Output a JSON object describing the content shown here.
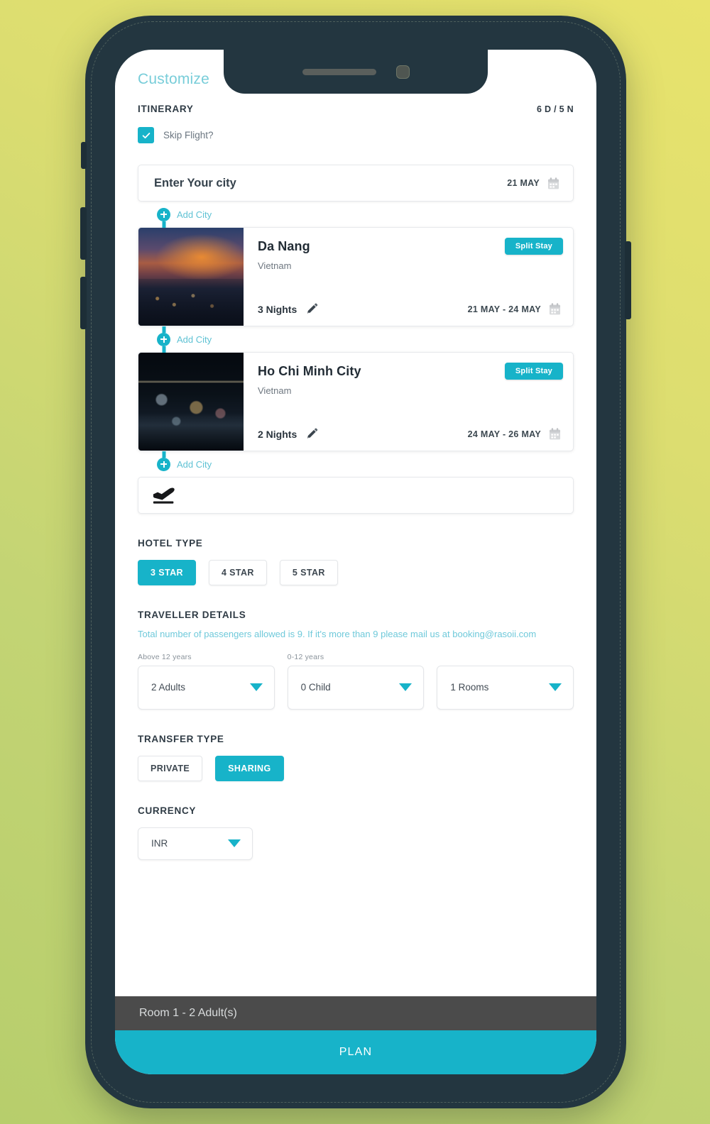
{
  "app": {
    "title": "Customize",
    "itinerary_label": "ITINERARY",
    "duration": "6 D / 5 N"
  },
  "skip_flight": {
    "label": "Skip Flight?",
    "checked": true,
    "check_icon": "check-icon"
  },
  "origin": {
    "placeholder": "Enter Your city",
    "date": "21 MAY",
    "calendar_icon": "calendar-icon"
  },
  "add_city_label": "Add City",
  "trips": [
    {
      "city": "Da Nang",
      "country": "Vietnam",
      "badge": "Split Stay",
      "nights": "3 Nights",
      "dates": "21 MAY - 24 MAY",
      "edit_icon": "pencil-icon",
      "calendar_icon": "calendar-icon"
    },
    {
      "city": "Ho Chi Minh City",
      "country": "Vietnam",
      "badge": "Split Stay",
      "nights": "2 Nights",
      "dates": "24 MAY - 26 MAY",
      "edit_icon": "pencil-icon",
      "calendar_icon": "calendar-icon"
    }
  ],
  "flight_row": {
    "icon": "plane-takeoff-icon"
  },
  "hotel_type": {
    "title": "HOTEL TYPE",
    "options": [
      {
        "label": "3 STAR",
        "selected": true
      },
      {
        "label": "4 STAR",
        "selected": false
      },
      {
        "label": "5 STAR",
        "selected": false
      }
    ]
  },
  "traveller": {
    "title": "TRAVELLER DETAILS",
    "helper": "Total number of passengers allowed is 9. If it's more than 9 please mail us at booking@rasoii.com",
    "adults": {
      "mini_label": "Above 12 years",
      "value": "2 Adults"
    },
    "children": {
      "mini_label": "0-12 years",
      "value": "0 Child"
    },
    "rooms": {
      "mini_label": "",
      "value": "1 Rooms"
    }
  },
  "transfer_type": {
    "title": "TRANSFER TYPE",
    "options": [
      {
        "label": "PRIVATE",
        "selected": false
      },
      {
        "label": "SHARING",
        "selected": true
      }
    ]
  },
  "currency": {
    "title": "CURRENCY",
    "value": "INR"
  },
  "bottom": {
    "room_summary": "Room 1 - 2 Adult(s)",
    "plan_button": "PLAN"
  },
  "colors": {
    "accent": "#17b3c9",
    "accent_light": "#6fc9da",
    "frame": "#233640",
    "room_bar": "#4b4b4b",
    "bg_green": "#b7ce6c",
    "bg_yellow": "#e8e36c"
  }
}
